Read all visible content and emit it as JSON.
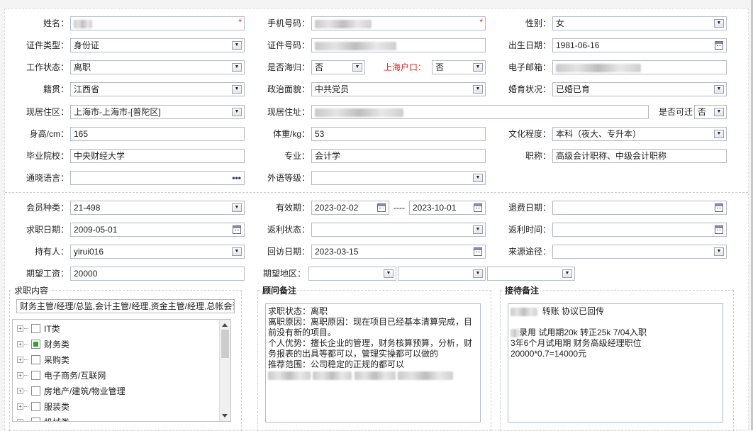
{
  "personal": {
    "name": {
      "label": "姓名：",
      "value": ""
    },
    "phone": {
      "label": "手机号码：",
      "value": ""
    },
    "gender": {
      "label": "性别：",
      "value": "女"
    },
    "id_type": {
      "label": "证件类型：",
      "value": "身份证"
    },
    "id_number": {
      "label": "证件号码：",
      "value": ""
    },
    "birth_date": {
      "label": "出生日期：",
      "value": "1981-06-16"
    },
    "work_status": {
      "label": "工作状态：",
      "value": "离职"
    },
    "overseas_return": {
      "label": "是否海归：",
      "value": "否"
    },
    "shanghai_hukou": {
      "label": "上海户口：",
      "value": "否"
    },
    "email": {
      "label": "电子邮箱：",
      "value": ""
    },
    "native_place": {
      "label": "籍贯：",
      "value": "江西省"
    },
    "political_status": {
      "label": "政治面貌：",
      "value": "中共党员"
    },
    "marital_status": {
      "label": "婚育状况：",
      "value": "已婚已育"
    },
    "current_residence": {
      "label": "现居住区：",
      "value": "上海市-上海市-[普陀区]"
    },
    "current_address": {
      "label": "现居住址：",
      "value": ""
    },
    "relocatable": {
      "label": "是否可迁",
      "value": "否"
    },
    "height": {
      "label": "身高/cm：",
      "value": "165"
    },
    "weight": {
      "label": "体重/kg：",
      "value": "53"
    },
    "education": {
      "label": "文化程度：",
      "value": "本科（夜大、专升本）"
    },
    "school": {
      "label": "毕业院校：",
      "value": "中央财经大学"
    },
    "major": {
      "label": "专业：",
      "value": "会计学"
    },
    "title": {
      "label": "职称：",
      "value": "高级会计职称、中级会计职称"
    },
    "languages": {
      "label": "通晓语言：",
      "value": ""
    },
    "foreign_level": {
      "label": "外语等级：",
      "value": ""
    }
  },
  "membership": {
    "member_type": {
      "label": "会员种类：",
      "value": "21-498"
    },
    "validity": {
      "label": "有效期：",
      "start": "2023-02-02",
      "sep": "----",
      "end": "2023-10-01"
    },
    "refund_date": {
      "label": "退费日期：",
      "value": ""
    },
    "job_seek_date": {
      "label": "求职日期：",
      "value": "2009-05-01"
    },
    "rebate_status": {
      "label": "返利状态：",
      "value": ""
    },
    "rebate_time": {
      "label": "返利时间：",
      "value": ""
    },
    "holder": {
      "label": "持有人：",
      "value": "yirui016"
    },
    "revisit_date": {
      "label": "回访日期：",
      "value": "2023-03-15"
    },
    "source": {
      "label": "来源途径：",
      "value": ""
    },
    "expected_salary": {
      "label": "期望工资：",
      "value": "20000"
    },
    "expected_region": {
      "label": "期望地区：",
      "values": [
        "",
        "",
        ""
      ]
    }
  },
  "job_content": {
    "legend": "求职内容",
    "positions": "财务主管/经理/总监,会计主管/经理,资金主管/经理,总帐会计",
    "tree": [
      {
        "label": "IT类",
        "checked": false
      },
      {
        "label": "财务类",
        "checked": true
      },
      {
        "label": "采购类",
        "checked": false
      },
      {
        "label": "电子商务/互联网",
        "checked": false
      },
      {
        "label": "房地产/建筑/物业管理",
        "checked": false
      },
      {
        "label": "服装类",
        "checked": false
      },
      {
        "label": "机械类",
        "checked": false
      }
    ]
  },
  "advisor_notes": {
    "legend": "顾问备注",
    "text": "求职状态：离职\n离职原因：离职原因：现在项目已经基本清算完成，目前没有新的项目。\n个人优势：擅长企业的管理，财务核算预算，分析，财务报表的出具等都可以，管理实操都可以做的\n推荐范围：公司稳定的正规的都可以"
  },
  "reception_notes": {
    "legend": "接待备注",
    "line1": "转账 协议已回传",
    "line2": "录用 试用期20k 转正25k 7/04入职",
    "line3": "3年6个月试用期 财务高级经理职位",
    "line4": "20000*0.7=14000元"
  },
  "colors": {
    "required": "#e02020",
    "border": "#b5b8c8",
    "checked": "#33a02c"
  }
}
